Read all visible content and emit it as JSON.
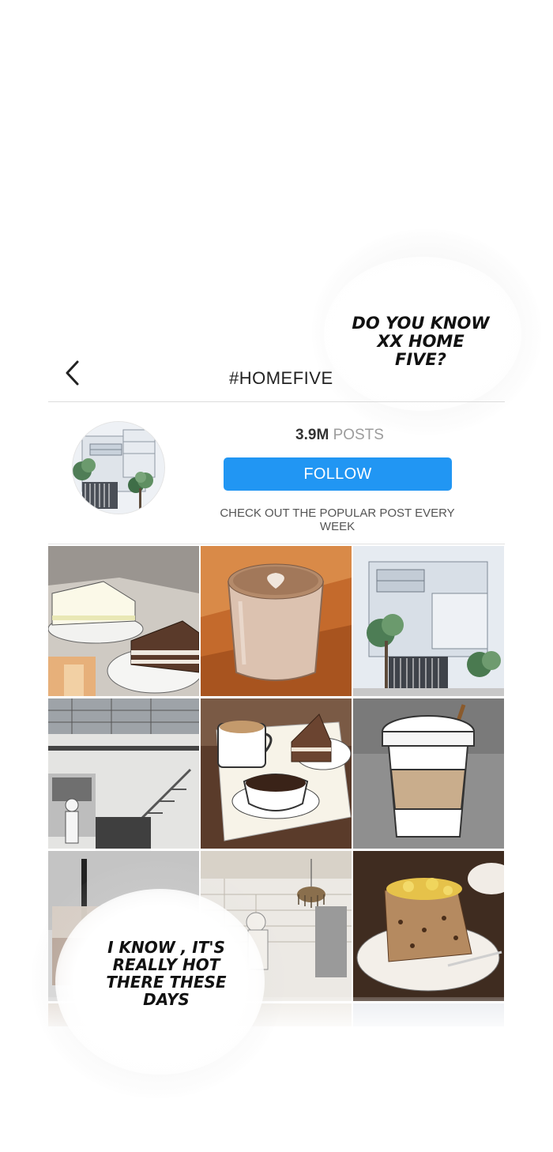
{
  "header": {
    "title": "#HOMEFIVE",
    "back_icon": "chevron-left-icon"
  },
  "profile": {
    "posts_count": "3.9M",
    "posts_label": "POSTS",
    "follow_label": "FOLLOW",
    "bio": "CHECK OUT THE POPULAR POST EVERY WEEK",
    "accent_color": "#2196f3"
  },
  "grid": {
    "tiles": [
      {
        "name": "cakes"
      },
      {
        "name": "latte"
      },
      {
        "name": "building"
      },
      {
        "name": "cafe-interior"
      },
      {
        "name": "coffee-and-cake"
      },
      {
        "name": "takeaway-cup"
      },
      {
        "name": "iced-drink"
      },
      {
        "name": "chandelier-room"
      },
      {
        "name": "cake-plate"
      }
    ]
  },
  "speech": {
    "top_bubble": "DO YOU KNOW XX HOME FIVE?",
    "bottom_bubble": "I KNOW , IT'S REALLY HOT THERE THESE DAYS"
  }
}
